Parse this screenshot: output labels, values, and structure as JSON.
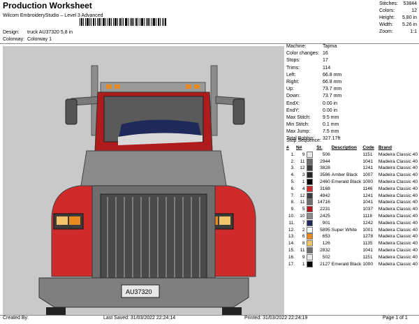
{
  "header": {
    "title": "Production Worksheet",
    "subtitle": "Wilcom EmbroideryStudio – Level 3 Advanced",
    "design_label": "Design:",
    "design_value": "truck AU37320 5,8 in",
    "colorway_label": "Colorway:",
    "colorway_value": "Colorway 1"
  },
  "summary": [
    {
      "label": "Stitches:",
      "value": "53844"
    },
    {
      "label": "Colors:",
      "value": "12"
    },
    {
      "label": "Height:",
      "value": "5.80 in"
    },
    {
      "label": "Width:",
      "value": "5.26 in"
    },
    {
      "label": "Zoom:",
      "value": "1:1"
    }
  ],
  "machine_stats": [
    {
      "label": "Machine:",
      "value": "Tajima"
    },
    {
      "label": "Color changes:",
      "value": "16"
    },
    {
      "label": "Stops:",
      "value": "17"
    },
    {
      "label": "Trims:",
      "value": "114"
    },
    {
      "label": "Left:",
      "value": "66.8 mm"
    },
    {
      "label": "Right:",
      "value": "66.8 mm"
    },
    {
      "label": "Up:",
      "value": "73.7 mm"
    },
    {
      "label": "Down:",
      "value": "73.7 mm"
    },
    {
      "label": "EndX:",
      "value": "0.00 in"
    },
    {
      "label": "EndY:",
      "value": "0.00 in"
    },
    {
      "label": "Max Stitch:",
      "value": "9.5 mm"
    },
    {
      "label": "Min Stitch:",
      "value": "0.1 mm"
    },
    {
      "label": "Max Jump:",
      "value": "7.5 mm"
    },
    {
      "label": "Total Bobbin:",
      "value": "327.17ft"
    }
  ],
  "stop_sequence_title": "Stop Sequence:",
  "stop_table": {
    "headers": [
      "#",
      "N#",
      "",
      "St.",
      "Description",
      "Code",
      "Brand"
    ],
    "rows": [
      {
        "idx": "1.",
        "n": "9",
        "color": "#e8e8e8",
        "st": "506",
        "desc": "",
        "code": "1151",
        "brand": "Madeira Classic 40"
      },
      {
        "idx": "2.",
        "n": "11",
        "color": "#6e6e6e",
        "st": "2944",
        "desc": "",
        "code": "1041",
        "brand": "Madeira Classic 40"
      },
      {
        "idx": "3.",
        "n": "12",
        "color": "#3c3c3c",
        "st": "3828",
        "desc": "",
        "code": "1241",
        "brand": "Madeira Classic 40"
      },
      {
        "idx": "4.",
        "n": "3",
        "color": "#262626",
        "st": "3586",
        "desc": "Amber Black",
        "code": "1007",
        "brand": "Madeira Classic 40"
      },
      {
        "idx": "5.",
        "n": "1",
        "color": "#000000",
        "st": "2460",
        "desc": "Emerald Black",
        "code": "1000",
        "brand": "Madeira Classic 40"
      },
      {
        "idx": "6.",
        "n": "4",
        "color": "#d02a2a",
        "st": "3168",
        "desc": "",
        "code": "1146",
        "brand": "Madeira Classic 40"
      },
      {
        "idx": "7.",
        "n": "12",
        "color": "#3c3c3c",
        "st": "4942",
        "desc": "",
        "code": "1241",
        "brand": "Madeira Classic 40"
      },
      {
        "idx": "8.",
        "n": "11",
        "color": "#6e6e6e",
        "st": "14716",
        "desc": "",
        "code": "1041",
        "brand": "Madeira Classic 40"
      },
      {
        "idx": "9.",
        "n": "5",
        "color": "#b01c1c",
        "st": "2231",
        "desc": "",
        "code": "1037",
        "brand": "Madeira Classic 40"
      },
      {
        "idx": "10.",
        "n": "10",
        "color": "#8a8a8a",
        "st": "2425",
        "desc": "",
        "code": "1118",
        "brand": "Madeira Classic 40"
      },
      {
        "idx": "11.",
        "n": "7",
        "color": "#1f2a5a",
        "st": "901",
        "desc": "",
        "code": "1242",
        "brand": "Madeira Classic 40"
      },
      {
        "idx": "12.",
        "n": "2",
        "color": "#ffffff",
        "st": "5895",
        "desc": "Super White",
        "code": "1001",
        "brand": "Madeira Classic 40"
      },
      {
        "idx": "13.",
        "n": "6",
        "color": "#e88a1e",
        "st": "653",
        "desc": "",
        "code": "1278",
        "brand": "Madeira Classic 40"
      },
      {
        "idx": "14.",
        "n": "8",
        "color": "#f2c46a",
        "st": "126",
        "desc": "",
        "code": "1135",
        "brand": "Madeira Classic 40"
      },
      {
        "idx": "15.",
        "n": "11",
        "color": "#6e6e6e",
        "st": "2832",
        "desc": "",
        "code": "1041",
        "brand": "Madeira Classic 40"
      },
      {
        "idx": "16.",
        "n": "9",
        "color": "#e8e8e8",
        "st": "502",
        "desc": "",
        "code": "1151",
        "brand": "Madeira Classic 40"
      },
      {
        "idx": "17.",
        "n": "1",
        "color": "#000000",
        "st": "2127",
        "desc": "Emerald Black",
        "code": "1000",
        "brand": "Madeira Classic 40"
      }
    ]
  },
  "design": {
    "license_plate": "AU37320",
    "grille_badge_left": "KW",
    "grille_badge_right": "KW"
  },
  "footer": {
    "created_by": "Created By:",
    "last_saved": "Last Saved: 31/03/2022 22:24:14",
    "printed": "Printed: 31/03/2022 22:24:19",
    "page": "Page 1 of 1"
  }
}
